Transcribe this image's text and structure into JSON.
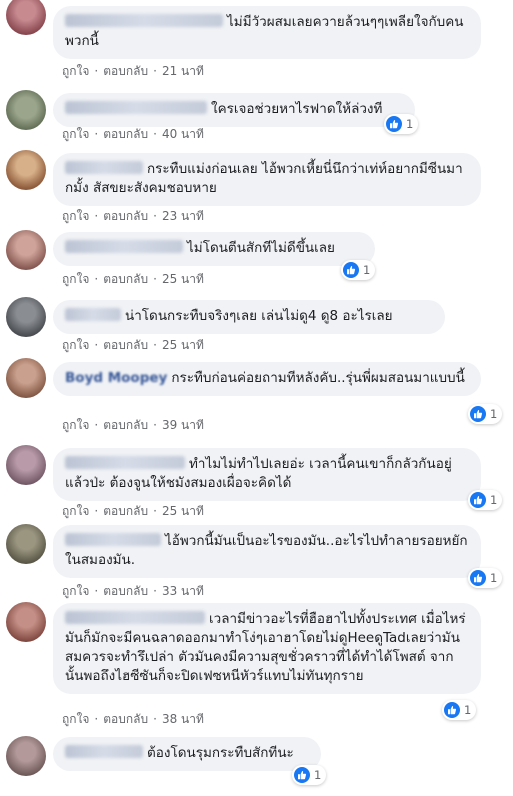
{
  "actions": {
    "like": "ถูกใจ",
    "reply": "ตอบกลับ",
    "separator": "·"
  },
  "comments": [
    {
      "text": "ไม่มีวัวผสมเลยควายล้วนๆๆเพลียใจกับคนพวกนี้",
      "time": "21 นาที"
    },
    {
      "text": "ใครเจอช่วยหาไรฟาดให้ล่วงที",
      "time": "40 นาที",
      "reactions": "1"
    },
    {
      "text": "กระทืบแม่งก่อนเลย ไอ้พวกเหี้ยนี่นึกว่าเท่ห์อยากมีซีนมากมั้ง สัสขยะสังคมชอบหาย",
      "time": "23 นาที"
    },
    {
      "text": "ไม่โดนตีนสักทีไม่ดีขึ้นเลย",
      "time": "25 นาที",
      "reactions": "1"
    },
    {
      "text": "น่าโดนกระทืบจริงๆเลย เล่นไม่ดู4 ดู8 อะไรเลย",
      "time": "25 นาที"
    },
    {
      "name": "Boyd Moopey",
      "text": "กระทืบก่อนค่อยถามทีหลังคับ..รุ่นพี่ผมสอนมาแบบนี้",
      "time": "39 นาที",
      "reactions": "1"
    },
    {
      "text": "ทำไมไม่ทำไปเลยอ่ะ เวลานี้คนเขาก็กลัวกันอยู่แล้วป่ะ ต้องจูนให้ชมังสมองเผื่อจะคิดได้",
      "time": "25 นาที",
      "reactions": "1"
    },
    {
      "text": "ไอ้พวกนี้มันเป็นอะไรของมัน..อะไรไปทำลายรอยหยักในสมองมัน.",
      "time": "33 นาที",
      "reactions": "1"
    },
    {
      "text": "เวลามีข่าวอะไรที่ฮือฮาไปทั้งประเทศ เมื่อไหร่ มันก็มักจะมีคนฉลาดออกมาทำโง่ๆเอาฮาโดยไม่ดูHeeดูTadเลยว่ามันสมควรจะทำรึเปล่า ตัวมันคงมีความสุขชั่วคราวที่ได้ทำได้โพสต์ จากนั้นพอถึงไฮซีซันก็จะปิดเฟซหนีหัวร์แทบไม่ทันทุกราย",
      "time": "38 นาที",
      "reactions": "1"
    },
    {
      "text": "ต้องโดนรุมกระทืบสักทีนะ",
      "time": "",
      "reactions": "1"
    }
  ]
}
